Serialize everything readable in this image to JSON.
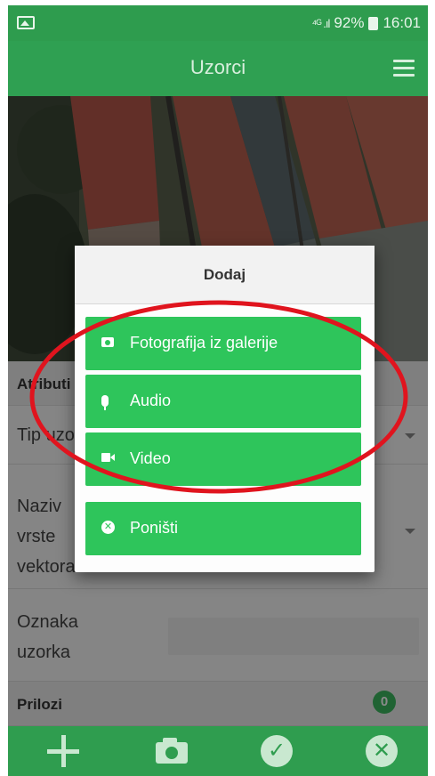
{
  "status_bar": {
    "battery": "92%",
    "time": "16:01",
    "signal": "⁴ᴳ .ıl"
  },
  "toolbar": {
    "title": "Uzorci"
  },
  "form": {
    "attributes_header": "Atributi",
    "type_label": "Tip uzorka",
    "name_label_lines": [
      "Naziv",
      "vrste",
      "vektora"
    ],
    "sample_mark_lines": [
      "Oznaka",
      "uzorka"
    ],
    "attachments_header": "Prilozi",
    "attachments_count": "0"
  },
  "dialog": {
    "title": "Dodaj",
    "options": [
      {
        "label": "Fotografija iz galerije",
        "icon": "camera-icon"
      },
      {
        "label": "Audio",
        "icon": "microphone-icon"
      },
      {
        "label": "Video",
        "icon": "video-camera-icon"
      }
    ],
    "cancel": {
      "label": "Poništi",
      "icon": "close-circle-icon"
    }
  },
  "bottom_bar": {
    "buttons": [
      "plus-icon",
      "camera-icon",
      "checkmark-icon",
      "close-icon"
    ]
  },
  "colors": {
    "app_green": "#2fa052",
    "button_green": "#2ec55b",
    "annotation_red": "#e0141e"
  }
}
